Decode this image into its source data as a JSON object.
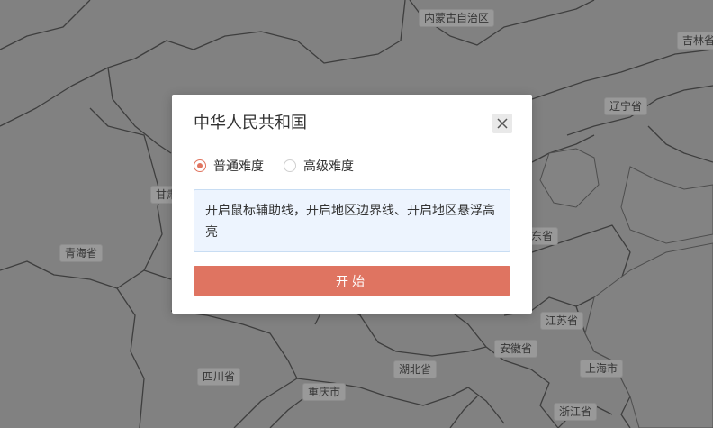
{
  "map": {
    "provinces": [
      {
        "name": "内蒙古自治区"
      },
      {
        "name": "吉林省"
      },
      {
        "name": "辽宁省"
      },
      {
        "name": "甘肃"
      },
      {
        "name": "青海省"
      },
      {
        "name": "东省"
      },
      {
        "name": "江苏省"
      },
      {
        "name": "安徽省"
      },
      {
        "name": "上海市"
      },
      {
        "name": "四川省"
      },
      {
        "name": "湖北省"
      },
      {
        "name": "重庆市"
      },
      {
        "name": "浙江省"
      }
    ]
  },
  "modal": {
    "title": "中华人民共和国",
    "difficulty": [
      {
        "label": "普通难度",
        "checked": true
      },
      {
        "label": "高级难度",
        "checked": false
      }
    ],
    "info": "开启鼠标辅助线，开启地区边界线、开启地区悬浮高亮",
    "start_label": "开始"
  },
  "colors": {
    "accent": "#df7461",
    "info_bg": "#edf4fe",
    "map_bg": "#8c8c8c"
  }
}
